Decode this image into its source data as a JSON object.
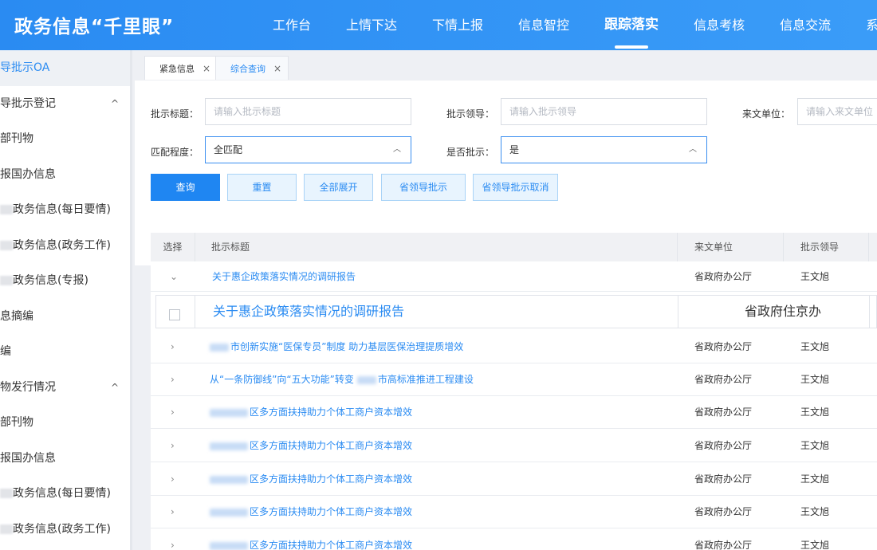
{
  "header": {
    "app_title": "政务信息“千里眼”",
    "nav": [
      "工作台",
      "上情下达",
      "下情上报",
      "信息智控",
      "跟踪落实",
      "信息考核",
      "信息交流",
      "系统管"
    ],
    "active_nav": "跟踪落实"
  },
  "sidebar": {
    "items": [
      {
        "label": "导批示OA",
        "active": true
      },
      {
        "label": "导批示登记",
        "chevron": "^"
      },
      {
        "label": "部刊物"
      },
      {
        "label": "报国办信息"
      },
      {
        "label": "政务信息(每日要情)",
        "blurred_prefix": true
      },
      {
        "label": "政务信息(政务工作)",
        "blurred_prefix": true
      },
      {
        "label": "政务信息(专报)",
        "blurred_prefix": true
      },
      {
        "label": "息摘编"
      },
      {
        "label": "编"
      },
      {
        "label": "物发行情况",
        "chevron": "^"
      },
      {
        "label": "部刊物"
      },
      {
        "label": "报国办信息"
      },
      {
        "label": "政务信息(每日要情)",
        "blurred_prefix": true
      },
      {
        "label": "政务信息(政务工作)",
        "blurred_prefix": true
      }
    ]
  },
  "tabs": [
    {
      "label": "紧急信息",
      "close": "×"
    },
    {
      "label": "综合查询",
      "close": "×",
      "active": true
    }
  ],
  "filters": {
    "title_label": "批示标题：",
    "title_placeholder": "请输入批示标题",
    "leader_label": "批示领导：",
    "leader_placeholder": "请输入批示领导",
    "unit_label": "来文单位：",
    "unit_placeholder": "请输入来文单位",
    "match_label": "匹配程度：",
    "match_value": "全匹配",
    "approved_label": "是否批示：",
    "approved_value": "是"
  },
  "buttons": {
    "query": "查询",
    "reset": "重置",
    "expand_all": "全部展开",
    "provincial_leader": "省领导批示",
    "provincial_leader_cancel": "省领导批示取消"
  },
  "table": {
    "headers": {
      "select": "选择",
      "title": "批示标题",
      "unit": "来文单位",
      "leader": "批示领导"
    },
    "rows": [
      {
        "expand": "⌄",
        "prefix": "",
        "title": "关于惠企政策落实情况的调研报告",
        "unit": "省政府办公厅",
        "leader": "王文旭"
      },
      {
        "expand": "›",
        "prefix": "short",
        "title": "市创新实施“医保专员”制度 助力基层医保治理提质增效",
        "unit": "省政府办公厅",
        "leader": "王文旭"
      },
      {
        "expand": "›",
        "prefix": "inline",
        "title_a": "从“一条防御线”向“五大功能”转变",
        "title_b": "市高标准推进工程建设",
        "unit": "省政府办公厅",
        "leader": "王文旭"
      },
      {
        "expand": "›",
        "prefix": "long",
        "title": "区多方面扶持助力个体工商户资本增效",
        "unit": "省政府办公厅",
        "leader": "王文旭"
      },
      {
        "expand": "›",
        "prefix": "long",
        "title": "区多方面扶持助力个体工商户资本增效",
        "unit": "省政府办公厅",
        "leader": "王文旭"
      },
      {
        "expand": "›",
        "prefix": "long",
        "title": "区多方面扶持助力个体工商户资本增效",
        "unit": "省政府办公厅",
        "leader": "王文旭"
      },
      {
        "expand": "›",
        "prefix": "long",
        "title": "区多方面扶持助力个体工商户资本增效",
        "unit": "省政府办公厅",
        "leader": "王文旭"
      },
      {
        "expand": "›",
        "prefix": "long",
        "title": "区多方面扶持助力个体工商户资本增效",
        "unit": "省政府办公厅",
        "leader": "王文旭"
      }
    ],
    "subrow": {
      "title": "关于惠企政策落实情况的调研报告",
      "unit": "省政府住京办"
    }
  },
  "colors": {
    "primary": "#2a8bf2",
    "header_bg": "#2a8bf2"
  }
}
